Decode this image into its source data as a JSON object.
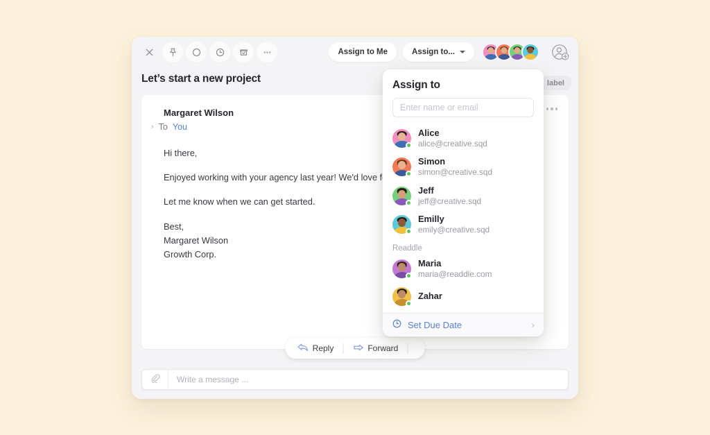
{
  "background_color": "#fcf1dc",
  "toolbar": {
    "icons": [
      {
        "name": "close-icon",
        "label": "Close"
      },
      {
        "name": "pin-icon",
        "label": "Pin"
      },
      {
        "name": "mark-unread-circle-icon",
        "label": "Mark as unread"
      },
      {
        "name": "clock-snooze-icon",
        "label": "Snooze"
      },
      {
        "name": "archive-check-icon",
        "label": "Archive"
      },
      {
        "name": "more-options-icon",
        "label": "More"
      }
    ],
    "assign_to_me_label": "Assign to Me",
    "assign_to_label": "Assign to...",
    "avatars": [
      {
        "name": "alice-avatar",
        "bg": "#f08ec0",
        "hair": "#241b17",
        "body": "#3e6fb5"
      },
      {
        "name": "simon-avatar",
        "bg": "#f0795a",
        "hair": "#6b3a1e",
        "body": "#3a5a9a"
      },
      {
        "name": "jeff-avatar",
        "bg": "#74d07a",
        "hair": "#241b17",
        "body": "#8a5ab8"
      },
      {
        "name": "emilly-avatar",
        "bg": "#5cc9d8",
        "hair": "#211a15",
        "body": "#f2c13c"
      }
    ],
    "add_person_label": "Add person"
  },
  "subject": "Let’s start a new project",
  "label_chip": "label",
  "email": {
    "sender": "Margaret Wilson",
    "to_prefix": "To",
    "to_recipient": "You",
    "paragraphs": [
      "Hi there,",
      "Enjoyed working with your agency last year! We'd love for you to build a new website for us.",
      "Let me know when we can get started."
    ],
    "signature": "Best,\nMargaret Wilson\nGrowth Corp.",
    "actions": [
      {
        "name": "reply-button",
        "label": "Reply",
        "icon": "reply-arrow-icon"
      },
      {
        "name": "forward-button",
        "label": "Forward",
        "icon": "forward-arrow-icon"
      }
    ],
    "more_icon": "more-options-icon"
  },
  "compose": {
    "attach_icon": "paperclip-icon",
    "placeholder": "Write a message ..."
  },
  "assign_panel": {
    "title": "Assign to",
    "search_placeholder": "Enter name or email",
    "contacts": [
      {
        "name": "Alice",
        "email": "alice@creative.sqd",
        "bg": "#f08ec0",
        "hair": "#241b17",
        "body": "#3e6fb5",
        "online": true
      },
      {
        "name": "Simon",
        "email": "simon@creative.sqd",
        "bg": "#f0795a",
        "hair": "#6b3a1e",
        "body": "#3a5a9a",
        "online": true
      },
      {
        "name": "Jeff",
        "email": "jeff@creative.sqd",
        "bg": "#74d07a",
        "hair": "#241b17",
        "body": "#8a5ab8",
        "online": true
      },
      {
        "name": "Emilly",
        "email": "emily@creative.sqd",
        "bg": "#5cc9d8",
        "hair": "#211a15",
        "body": "#f2c13c",
        "online": true
      }
    ],
    "group_label": "Readdle",
    "group_contacts": [
      {
        "name": "Maria",
        "email": "maria@readdle.com",
        "bg": "#c07ad0",
        "hair": "#2b2320",
        "body": "#7a4ea8",
        "online": true
      },
      {
        "name": "Zahar",
        "email": "",
        "bg": "#f0c048",
        "hair": "#241b17",
        "body": "#c8902c",
        "online": true
      }
    ],
    "footer": {
      "icon": "clock-icon",
      "label": "Set Due Date",
      "chevron": "›",
      "accent": "#5a7fd4"
    }
  }
}
